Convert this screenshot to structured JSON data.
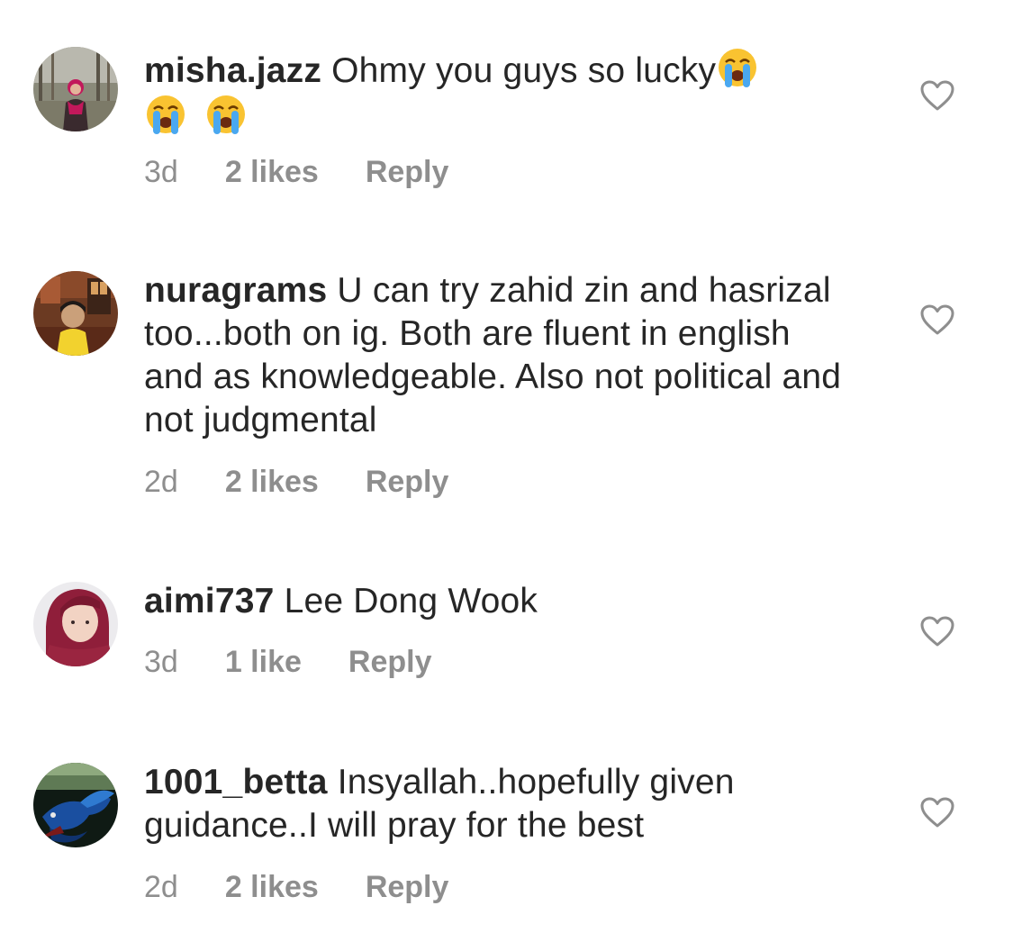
{
  "comments": [
    {
      "username": "misha.jazz",
      "text": "Ohmy you guys so lucky",
      "emojis": [
        "loudly-crying-face",
        "loudly-crying-face",
        "loudly-crying-face"
      ],
      "time": "3d",
      "likes": "2 likes",
      "reply": "Reply",
      "avatar_icon": "user-avatar-icon"
    },
    {
      "username": "nuragrams",
      "text": "U can try zahid zin and hasrizal too...both on ig. Both are fluent in english and as knowledgeable. Also not political and not judgmental",
      "time": "2d",
      "likes": "2 likes",
      "reply": "Reply",
      "avatar_icon": "user-avatar-icon"
    },
    {
      "username": "aimi737",
      "text": "Lee Dong Wook",
      "time": "3d",
      "likes": "1 like",
      "reply": "Reply",
      "avatar_icon": "user-avatar-icon"
    },
    {
      "username": "1001_betta",
      "text": "Insyallah..hopefully given guidance..I will pray for the best",
      "time": "2d",
      "likes": "2 likes",
      "reply": "Reply",
      "avatar_icon": "betta-fish-avatar-icon"
    }
  ],
  "colors": {
    "text": "#262626",
    "meta": "#8e8e8e",
    "heart_outline": "#8e8e8e"
  }
}
